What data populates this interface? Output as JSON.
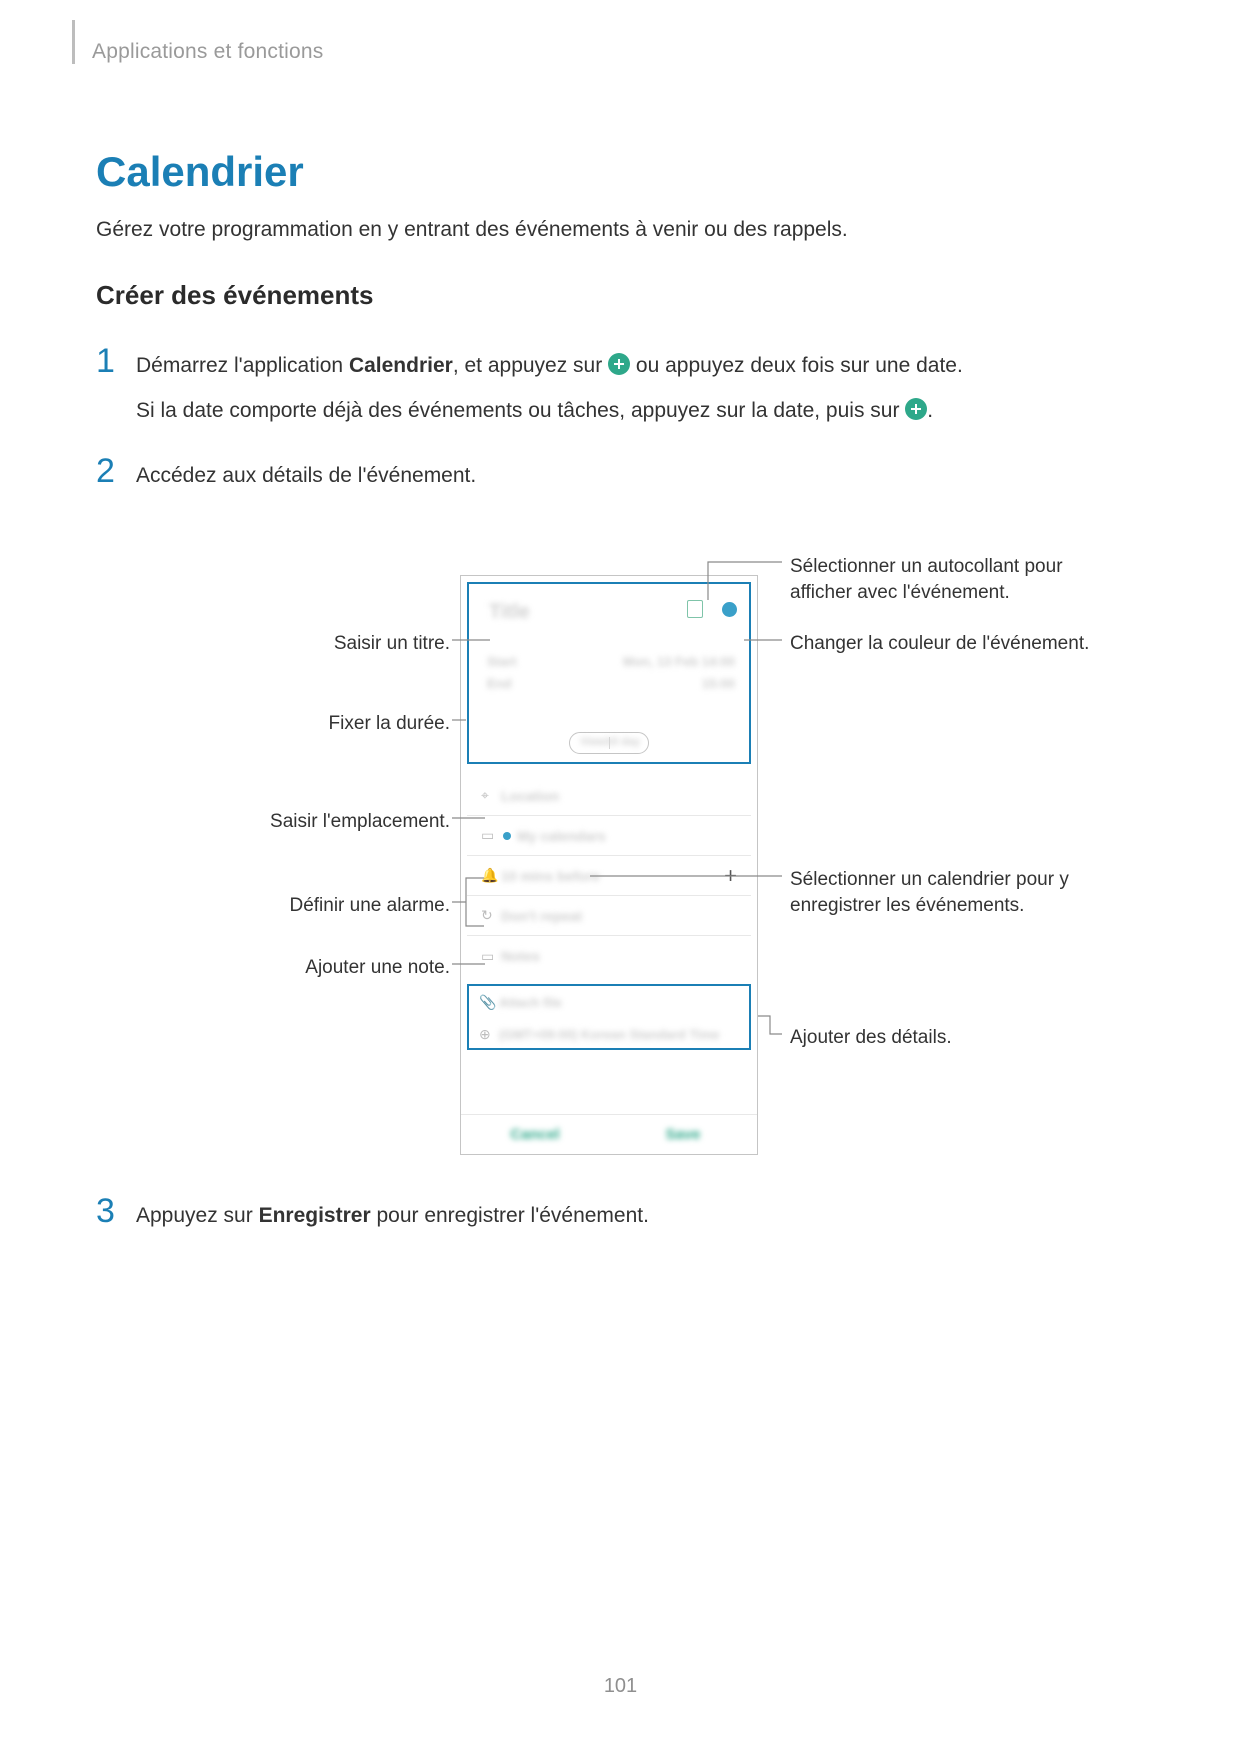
{
  "breadcrumb": "Applications et fonctions",
  "title": "Calendrier",
  "intro": "Gérez votre programmation en y entrant des événements à venir ou des rappels.",
  "h3": "Créer des événements",
  "step1": {
    "num": "1",
    "pre": "Démarrez l'application ",
    "app": "Calendrier",
    "mid": ", et appuyez sur ",
    "post": " ou appuyez deux fois sur une date.",
    "line2a": "Si la date comporte déjà des événements ou tâches, appuyez sur la date, puis sur ",
    "line2b": "."
  },
  "step2": {
    "num": "2",
    "text": "Accédez aux détails de l'événement."
  },
  "step3": {
    "num": "3",
    "pre": "Appuyez sur ",
    "bold": "Enregistrer",
    "post": " pour enregistrer l'événement."
  },
  "callouts": {
    "title": "Saisir un titre.",
    "duration": "Fixer la durée.",
    "location": "Saisir l'emplacement.",
    "alarm": "Définir une alarme.",
    "note": "Ajouter une note.",
    "sticker": "Sélectionner un autocollant pour afficher avec l'événement.",
    "color": "Changer la couleur de l'événement.",
    "calendar": "Sélectionner un calendrier pour y enregistrer les événements.",
    "details": "Ajouter des détails."
  },
  "mock": {
    "title_placeholder": "Title",
    "start": "Start",
    "end": "End",
    "start_time": "Mon, 13 Feb  14:00",
    "end_time": "15:00",
    "view": "View",
    "allday": "All day",
    "location": "Location",
    "calendar": "My calendars",
    "alarm": "10 mins before",
    "repeat": "Don't repeat",
    "notes": "Notes",
    "attach": "Attach file",
    "timezone": "(GMT+09:00) Korean Standard Time",
    "cancel": "Cancel",
    "save": "Save"
  },
  "page_number": "101"
}
